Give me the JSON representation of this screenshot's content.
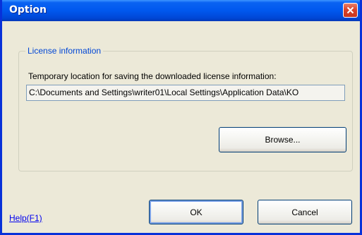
{
  "window": {
    "title": "Option"
  },
  "license_group": {
    "legend": "License information",
    "path_label": "Temporary location for saving the downloaded license information:",
    "path_value": "C:\\Documents and Settings\\writer01\\Local Settings\\Application Data\\KO",
    "browse_label": "Browse..."
  },
  "footer": {
    "help_link": "Help(F1)",
    "ok_label": "OK",
    "cancel_label": "Cancel"
  },
  "icons": {
    "close": "close-icon"
  },
  "colors": {
    "titlebar": "#0058ee",
    "close_button": "#d9432a",
    "dialog_background": "#ece9d8",
    "group_legend": "#0046d5",
    "link": "#0000ee"
  }
}
